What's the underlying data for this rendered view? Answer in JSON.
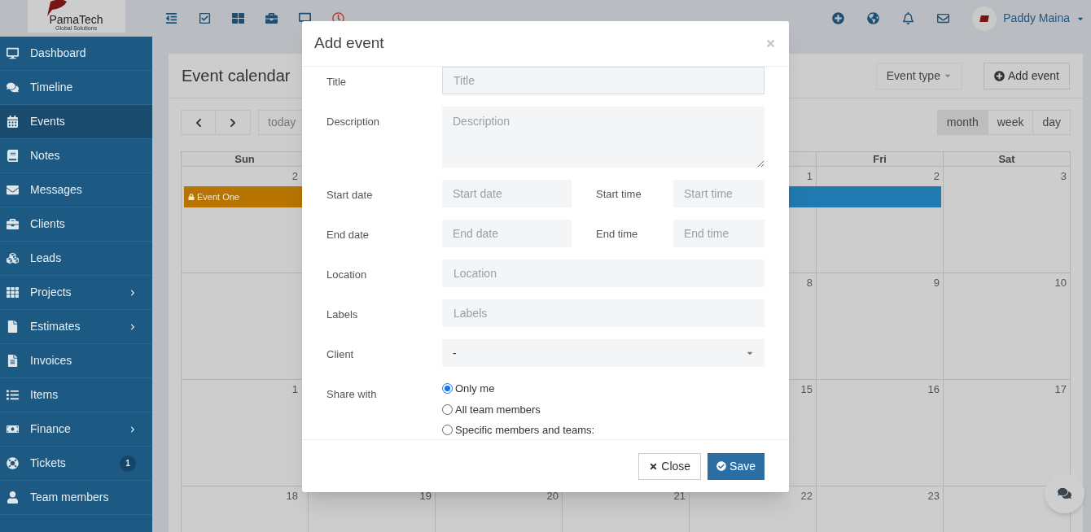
{
  "logo": {
    "name": "PamaTech",
    "tagline": "Global Solutions"
  },
  "user": {
    "name": "Paddy Maina"
  },
  "sidebar": {
    "items": [
      {
        "label": "Dashboard",
        "selected": false
      },
      {
        "label": "Timeline",
        "selected": false
      },
      {
        "label": "Events",
        "selected": true
      },
      {
        "label": "Notes",
        "selected": false
      },
      {
        "label": "Messages",
        "selected": false
      },
      {
        "label": "Clients",
        "selected": false
      },
      {
        "label": "Leads",
        "selected": false
      },
      {
        "label": "Projects",
        "selected": false,
        "submenu": true
      },
      {
        "label": "Estimates",
        "selected": false,
        "submenu": true
      },
      {
        "label": "Invoices",
        "selected": false
      },
      {
        "label": "Items",
        "selected": false
      },
      {
        "label": "Finance",
        "selected": false,
        "submenu": true
      },
      {
        "label": "Tickets",
        "selected": false,
        "badge": "1"
      },
      {
        "label": "Team members",
        "selected": false
      }
    ]
  },
  "page": {
    "title": "Event calendar",
    "filter": "Event type",
    "add_button": "Add event",
    "today": "today",
    "views": [
      {
        "label": "month",
        "selected": true
      },
      {
        "label": "week",
        "selected": false
      },
      {
        "label": "day",
        "selected": false
      }
    ]
  },
  "calendar": {
    "columns": {
      "sun": "Sun",
      "fri": "Fri",
      "sat": "Sat"
    },
    "weeks": [
      {
        "days": {
          "sun": "2",
          "thu": "1",
          "fri": "2",
          "sat": "3"
        },
        "events": [
          {
            "title": "Event One",
            "color": "#b87400",
            "locked": true
          },
          {
            "color": "#2079b0"
          }
        ]
      },
      {
        "days": {
          "thu": "8",
          "fri": "9",
          "sat": "10"
        }
      },
      {
        "days": {
          "sun": "1",
          "thu": "15",
          "fri": "16",
          "sat": "17"
        }
      },
      {
        "days": {
          "sun": "18",
          "mon": "19",
          "tue": "20",
          "wed": "21",
          "thu": "22",
          "fri": "23"
        }
      }
    ]
  },
  "modal": {
    "title": "Add event",
    "fields": [
      {
        "kind": "text",
        "label": "Title",
        "placeholder": "Title",
        "focused": true
      },
      {
        "kind": "textarea",
        "label": "Description",
        "placeholder": "Description"
      },
      {
        "kind": "pair",
        "label": "Start date",
        "placeholder": "Start date",
        "label2": "Start time",
        "placeholder2": "Start time"
      },
      {
        "kind": "pair",
        "label": "End date",
        "placeholder": "End date",
        "label2": "End time",
        "placeholder2": "End time"
      },
      {
        "kind": "text",
        "label": "Location",
        "placeholder": "Location"
      },
      {
        "kind": "text",
        "label": "Labels",
        "placeholder": "Labels"
      },
      {
        "kind": "select",
        "label": "Client",
        "value": "-"
      },
      {
        "kind": "radios",
        "label": "Share with",
        "options": [
          {
            "label": "Only me",
            "selected": true
          },
          {
            "label": "All team members",
            "selected": false
          },
          {
            "label": "Specific members and teams:",
            "selected": false
          }
        ]
      }
    ],
    "buttons": {
      "close": "Close",
      "save": "Save"
    }
  }
}
